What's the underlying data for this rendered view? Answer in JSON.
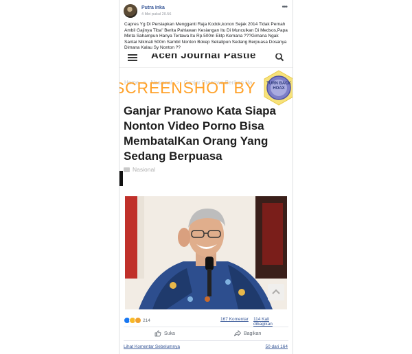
{
  "post": {
    "author": "Putra Inka",
    "timestamp": "4 Mei pukul 20.56",
    "more_icon": "more-horizontal-icon",
    "caption": "Capres Yg Di Persiapkan Mengganti Raja Kodok,konon Sejak 2014 Tidak Pernah Ambil Gajinya Tiba\" Berita Pahlawan Kesiangan Itu Di Munculkan Di Medsos,Papa Minta Sahampun Hanya Tertawa Itu Rp.500m Ektp Kemana ???Gimana Ngak Santai Nikmati 500m Sambil Nonton Bokep Sekalipun Sedang Berpuasa Dosanya Dimana Kalau Sy Nonton ??"
  },
  "screenshot": {
    "site_name": "Aceh Journal Pastie",
    "breadcrumbs": [
      "Home",
      ">",
      "Nasional",
      ">",
      "Ganjar Pranowo Berikan Ha"
    ],
    "watermark": "SCREENSHOT BY",
    "badge_text": "TURN BACK HOAX",
    "headline": "Ganjar Pranowo Kata Siapa Nonton Video Porno Bisa MembatalKan Orang Yang Sedang Berpuasa",
    "category": "Nasional"
  },
  "stats": {
    "reaction_count": "214",
    "comments": "167 Komentar",
    "shares": "114 Kali dibagikan"
  },
  "actions": {
    "like_label": "Suka",
    "share_label": "Bagikan"
  },
  "footer": {
    "more_comments": "Lihat Komentar Sebelumnya",
    "comment_count": "50 dari 164"
  },
  "colors": {
    "link": "#385898",
    "watermark": "#ff9d1e",
    "badge": "#5a5fb0"
  }
}
